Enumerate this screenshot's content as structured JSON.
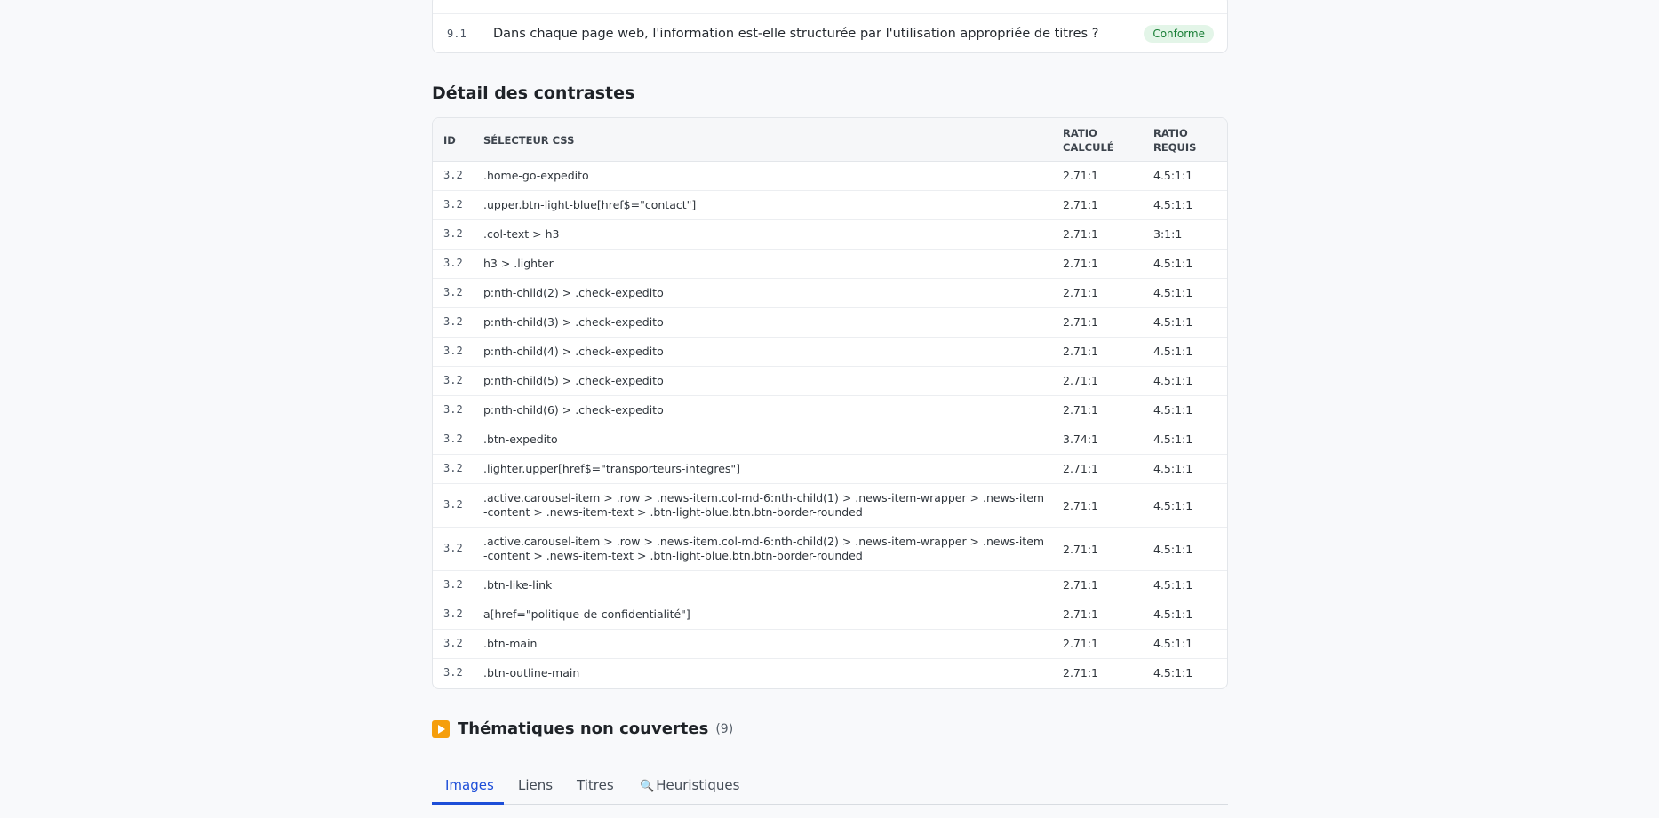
{
  "criteria": {
    "id": "9.1",
    "text": "Dans chaque page web, l'information est-elle structurée par l'utilisation appropriée de titres ?",
    "status": "Conforme"
  },
  "contrast_section": {
    "title": "Détail des contrastes",
    "headers": {
      "id": "ID",
      "selector": "SÉLECTEUR CSS",
      "calc": "RATIO CALCULÉ",
      "req": "RATIO REQUIS"
    },
    "rows": [
      {
        "id": "3.2",
        "selector": ".home-go-expedito",
        "calc": "2.71:1",
        "req": "4.5:1:1"
      },
      {
        "id": "3.2",
        "selector": ".upper.btn-light-blue[href$=\"contact\"]",
        "calc": "2.71:1",
        "req": "4.5:1:1"
      },
      {
        "id": "3.2",
        "selector": ".col-text > h3",
        "calc": "2.71:1",
        "req": "3:1:1"
      },
      {
        "id": "3.2",
        "selector": "h3 > .lighter",
        "calc": "2.71:1",
        "req": "4.5:1:1"
      },
      {
        "id": "3.2",
        "selector": "p:nth-child(2) > .check-expedito",
        "calc": "2.71:1",
        "req": "4.5:1:1"
      },
      {
        "id": "3.2",
        "selector": "p:nth-child(3) > .check-expedito",
        "calc": "2.71:1",
        "req": "4.5:1:1"
      },
      {
        "id": "3.2",
        "selector": "p:nth-child(4) > .check-expedito",
        "calc": "2.71:1",
        "req": "4.5:1:1"
      },
      {
        "id": "3.2",
        "selector": "p:nth-child(5) > .check-expedito",
        "calc": "2.71:1",
        "req": "4.5:1:1"
      },
      {
        "id": "3.2",
        "selector": "p:nth-child(6) > .check-expedito",
        "calc": "2.71:1",
        "req": "4.5:1:1"
      },
      {
        "id": "3.2",
        "selector": ".btn-expedito",
        "calc": "3.74:1",
        "req": "4.5:1:1"
      },
      {
        "id": "3.2",
        "selector": ".lighter.upper[href$=\"transporteurs-integres\"]",
        "calc": "2.71:1",
        "req": "4.5:1:1"
      },
      {
        "id": "3.2",
        "selector": ".active.carousel-item > .row > .news-item.col-md-6:nth-child(1) > .news-item-wrapper > .news-item-content > .news-item-text > .btn-light-blue.btn.btn-border-rounded",
        "calc": "2.71:1",
        "req": "4.5:1:1"
      },
      {
        "id": "3.2",
        "selector": ".active.carousel-item > .row > .news-item.col-md-6:nth-child(2) > .news-item-wrapper > .news-item-content > .news-item-text > .btn-light-blue.btn.btn-border-rounded",
        "calc": "2.71:1",
        "req": "4.5:1:1"
      },
      {
        "id": "3.2",
        "selector": ".btn-like-link",
        "calc": "2.71:1",
        "req": "4.5:1:1"
      },
      {
        "id": "3.2",
        "selector": "a[href=\"politique-de-confidentialité\"]",
        "calc": "2.71:1",
        "req": "4.5:1:1"
      },
      {
        "id": "3.2",
        "selector": ".btn-main",
        "calc": "2.71:1",
        "req": "4.5:1:1"
      },
      {
        "id": "3.2",
        "selector": ".btn-outline-main",
        "calc": "2.71:1",
        "req": "4.5:1:1"
      }
    ]
  },
  "uncovered": {
    "icon": "play-icon",
    "title": "Thématiques non couvertes",
    "count": "(9)"
  },
  "tabs": [
    {
      "label": "Images",
      "active": true
    },
    {
      "label": "Liens",
      "active": false
    },
    {
      "label": "Titres",
      "active": false
    },
    {
      "label": "Heuristiques",
      "active": false,
      "icon": "🔍"
    }
  ],
  "colors": {
    "accent": "#1d4ed8",
    "success": "#1a7f37",
    "success_bg": "#e3f5e8",
    "warning": "#f59e0b"
  }
}
